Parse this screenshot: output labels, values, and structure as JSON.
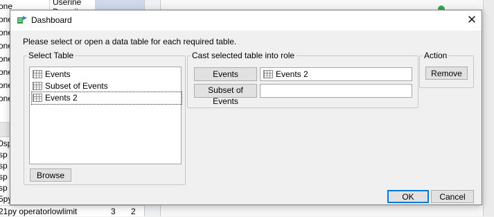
{
  "background": {
    "left_rows": [
      "one",
      "one",
      "one",
      "one",
      "one",
      "one",
      "one",
      "one"
    ],
    "col2_rows": [
      "Userine",
      "Descrii"
    ],
    "lower_rows": [
      "0sp",
      "sp c",
      "sp c",
      "sp c",
      "sp c",
      "5py"
    ],
    "bottom_row": {
      "name": "21py operatorlowlimit",
      "v1": "3",
      "v2": "2"
    }
  },
  "dialog": {
    "title": "Dashboard",
    "close_glyph": "✕",
    "instruction": "Please select or open a data table for each required table.",
    "select_table": {
      "legend": "Select Table",
      "items": [
        {
          "label": "Events",
          "selected": false
        },
        {
          "label": "Subset of Events",
          "selected": false
        },
        {
          "label": "Events 2",
          "selected": true
        }
      ],
      "browse_label": "Browse"
    },
    "cast": {
      "legend": "Cast selected table into role",
      "roles": [
        {
          "button_label": "Events",
          "value": "Events 2"
        },
        {
          "button_label": "Subset of Events",
          "value": ""
        }
      ]
    },
    "action": {
      "legend": "Action",
      "remove_label": "Remove"
    },
    "ok_label": "OK",
    "cancel_label": "Cancel",
    "colors": {
      "accent": "#0078d7",
      "title_bg": "#ffffff",
      "icon_green": "#2e9d4c"
    }
  }
}
